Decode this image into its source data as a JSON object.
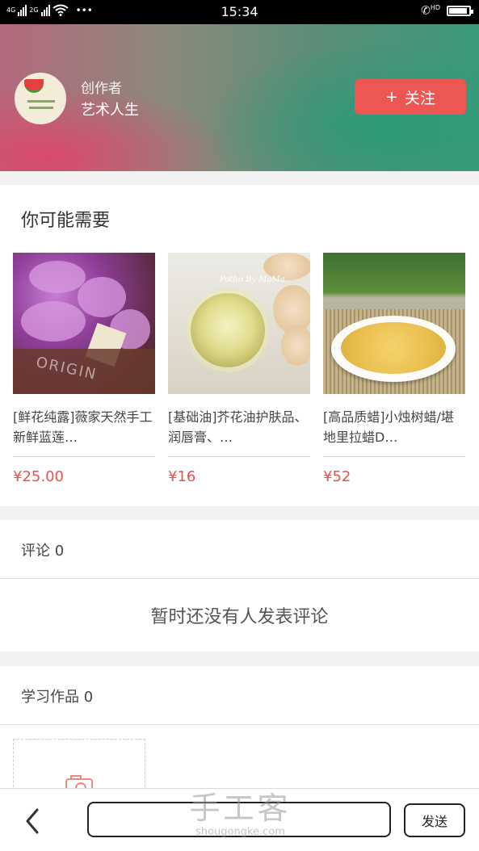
{
  "status_bar": {
    "network_left": "4G",
    "network_right": "2G",
    "time": "15:34",
    "hd_label": "HD",
    "dots": "•••"
  },
  "author": {
    "role": "创作者",
    "name": "艺术人生",
    "follow_icon": "+",
    "follow_label": "关注"
  },
  "recommend": {
    "title": "你可能需要",
    "products": [
      {
        "name": "[鲜花纯露]薇家天然手工新鲜蓝莲…",
        "price": "¥25.00",
        "image_icon": "flower-photo",
        "box_text": "ORIGIN"
      },
      {
        "name": "[基础油]芥花油护肤品、润唇膏、…",
        "price": "¥16",
        "image_icon": "oil-photo",
        "watermark": "Potho By MaMa"
      },
      {
        "name": "[高品质蜡]小烛树蜡/堪地里拉蜡D…",
        "price": "¥52",
        "image_icon": "wax-photo"
      }
    ]
  },
  "comments": {
    "header": "评论 0",
    "empty_text": "暂时还没有人发表评论"
  },
  "works": {
    "header": "学习作品 0"
  },
  "bottom_bar": {
    "back_icon": "‹",
    "input_placeholder": "",
    "send_label": "发送",
    "watermark_cn": "手工客",
    "watermark_en": "shougongke.com"
  },
  "colors": {
    "accent": "#ed5753",
    "price": "#e4534d"
  }
}
